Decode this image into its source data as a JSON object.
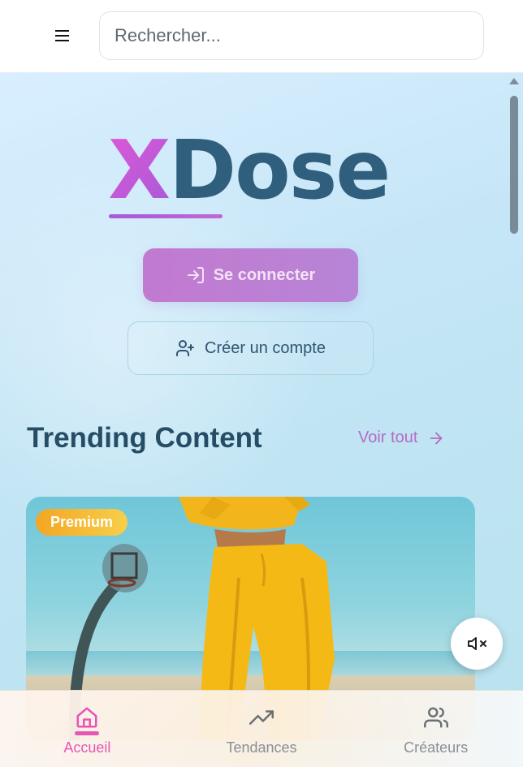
{
  "header": {
    "menu_icon": "hamburger-icon",
    "search": {
      "placeholder": "Rechercher...",
      "value": ""
    }
  },
  "hero": {
    "logo_prefix": "X",
    "logo_rest": "Dose",
    "login_label": "Se connecter",
    "login_icon": "login-icon",
    "signup_label": "Créer un compte",
    "signup_icon": "user-plus-icon"
  },
  "trending": {
    "title": "Trending Content",
    "see_all_label": "Voir tout",
    "see_all_icon": "arrow-right-icon",
    "cards": [
      {
        "badge": "Premium"
      }
    ]
  },
  "mute_icon": "volume-mute-icon",
  "bottom_nav": {
    "items": [
      {
        "label": "Accueil",
        "icon": "home-icon",
        "active": true
      },
      {
        "label": "Tendances",
        "icon": "trending-up-icon",
        "active": false
      },
      {
        "label": "Créateurs",
        "icon": "users-icon",
        "active": false
      }
    ]
  },
  "colors": {
    "accent_pink": "#e855b4",
    "accent_purple": "#a45ad8",
    "brand_dark": "#2f5f7c",
    "badge_gold": "#f4a623"
  }
}
